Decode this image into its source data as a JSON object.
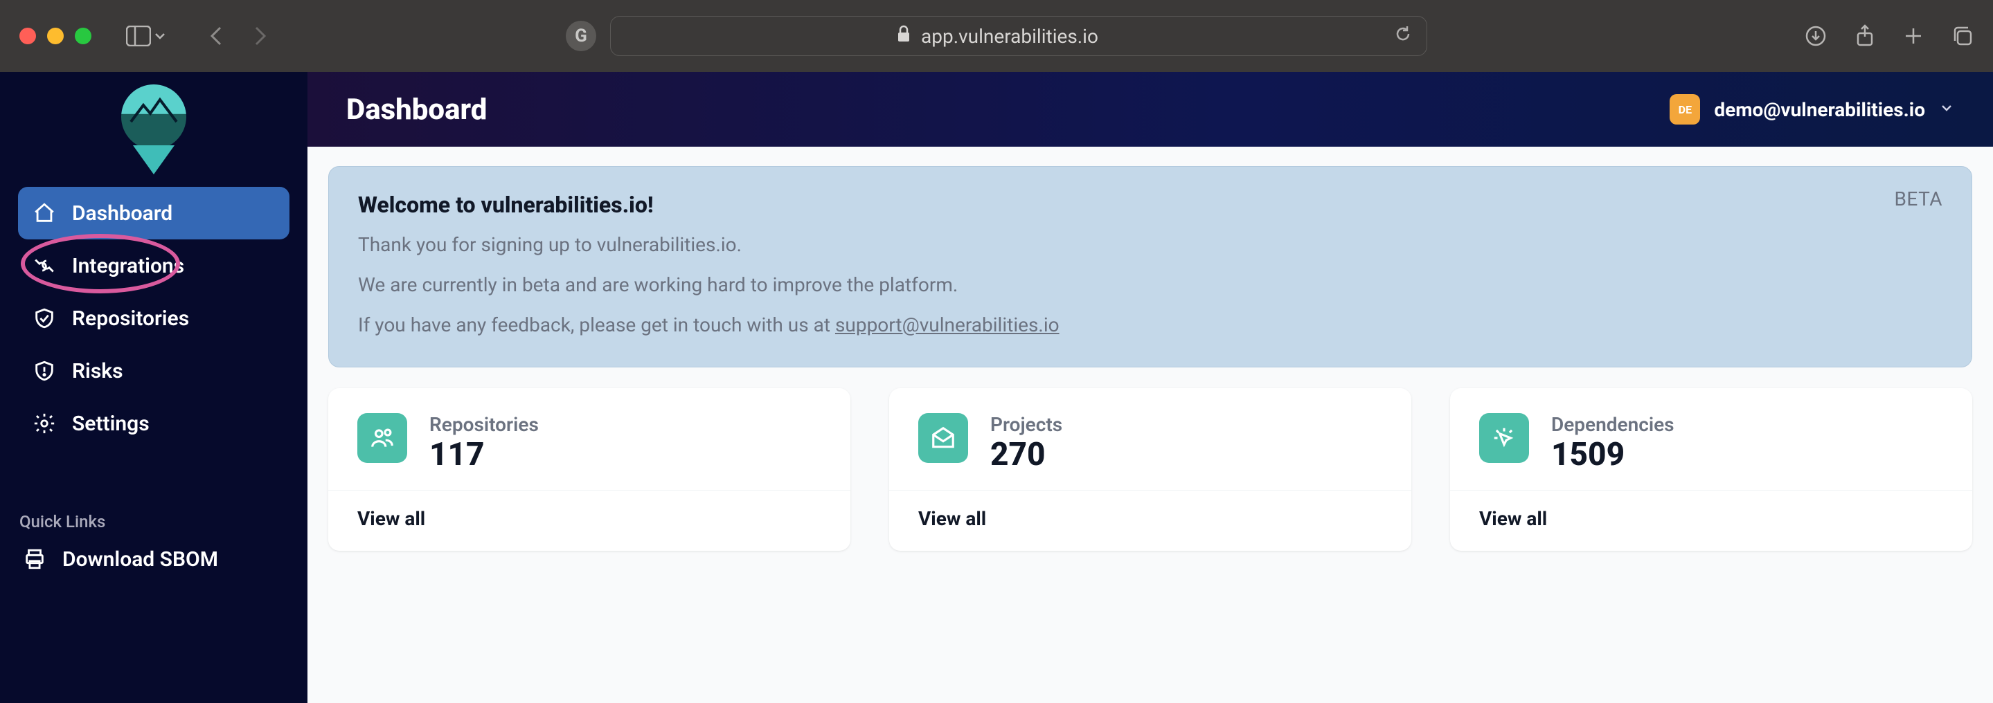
{
  "browser": {
    "url_host": "app.vulnerabilities.io"
  },
  "sidebar": {
    "items": [
      {
        "label": "Dashboard"
      },
      {
        "label": "Integrations"
      },
      {
        "label": "Repositories"
      },
      {
        "label": "Risks"
      },
      {
        "label": "Settings"
      }
    ],
    "quick_links_heading": "Quick Links",
    "quick_links": [
      {
        "label": "Download SBOM"
      }
    ]
  },
  "header": {
    "title": "Dashboard",
    "avatar_initials": "DE",
    "user_email": "demo@vulnerabilities.io"
  },
  "welcome": {
    "title": "Welcome to vulnerabilities.io!",
    "line1": "Thank you for signing up to vulnerabilities.io.",
    "line2": "We are currently in beta and are working hard to improve the platform.",
    "line3_prefix": "If you have any feedback, please get in touch with us at ",
    "support_email": "support@vulnerabilities.io",
    "beta_label": "BETA"
  },
  "cards": [
    {
      "label": "Repositories",
      "value": "117",
      "view_all": "View all"
    },
    {
      "label": "Projects",
      "value": "270",
      "view_all": "View all"
    },
    {
      "label": "Dependencies",
      "value": "1509",
      "view_all": "View all"
    }
  ]
}
